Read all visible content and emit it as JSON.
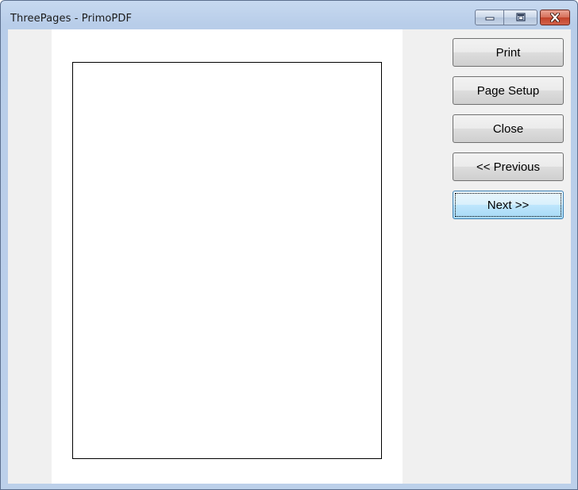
{
  "window": {
    "title": "ThreePages - PrimoPDF"
  },
  "caption_buttons": {
    "minimize_icon": "minimize-icon",
    "maximize_icon": "maximize-icon",
    "close_icon": "close-icon",
    "close_color": "#c7432b"
  },
  "actions": {
    "print": "Print",
    "page_setup": "Page Setup",
    "close": "Close",
    "previous": "<< Previous",
    "next": "Next >>"
  },
  "colors": {
    "focused_button": "#bee6fd",
    "panel_background": "#f0f0f0"
  }
}
